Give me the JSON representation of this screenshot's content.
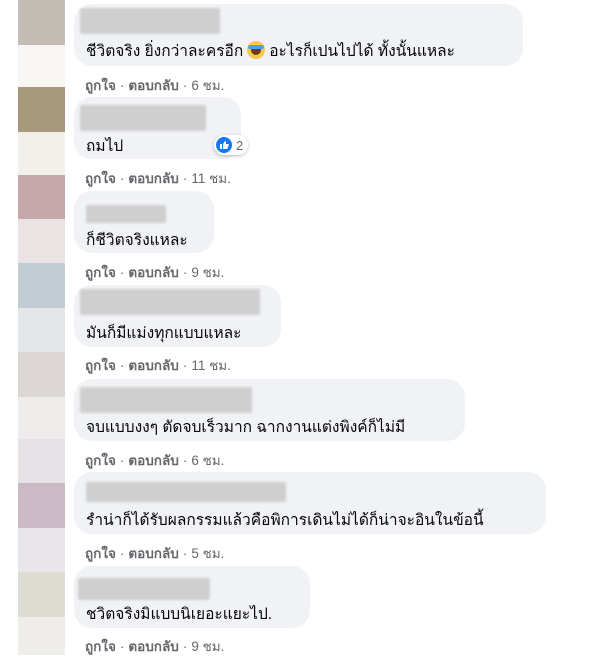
{
  "comments": [
    {
      "text_before": "ชีวิตจริง ยิ่งกว่าละครอีก",
      "emoji": "laughing-with-tears-emoji",
      "text_after": "อะไรก็เปนไปได้ ทั้งนั้นแหละ",
      "like": "ถูกใจ",
      "reply": "ตอบกลับ",
      "time": "6 ชม."
    },
    {
      "text": "ถมไป",
      "reaction_count": "2",
      "like": "ถูกใจ",
      "reply": "ตอบกลับ",
      "time": "11 ชม."
    },
    {
      "text": "ก็ชีวิตจริงแหละ",
      "like": "ถูกใจ",
      "reply": "ตอบกลับ",
      "time": "9 ชม."
    },
    {
      "text": "มันก็มีแม่งทุกแบบแหละ",
      "like": "ถูกใจ",
      "reply": "ตอบกลับ",
      "time": "11 ชม."
    },
    {
      "text": "จบแบบงงๆ ตัดจบเร็วมาก ฉากงานแต่งพิงค์ก็ไม่มี",
      "like": "ถูกใจ",
      "reply": "ตอบกลับ",
      "time": "6 ชม."
    },
    {
      "text": "รำน่าก็ได้รับผลกรรมแล้วคือพิการเดินไม่ได้ก็น่าจะอินในข้อนี้",
      "like": "ถูกใจ",
      "reply": "ตอบกลับ",
      "time": "5 ชม."
    },
    {
      "text": "ชวิตจริงมิแบบนิเยอะแยะไป.",
      "like": "ถูกใจ",
      "reply": "ตอบกลับ",
      "time": "9 ชม."
    }
  ],
  "colors": {
    "bubble": "#f0f2f5",
    "meta": "#65676b",
    "accent": "#1877f2"
  }
}
